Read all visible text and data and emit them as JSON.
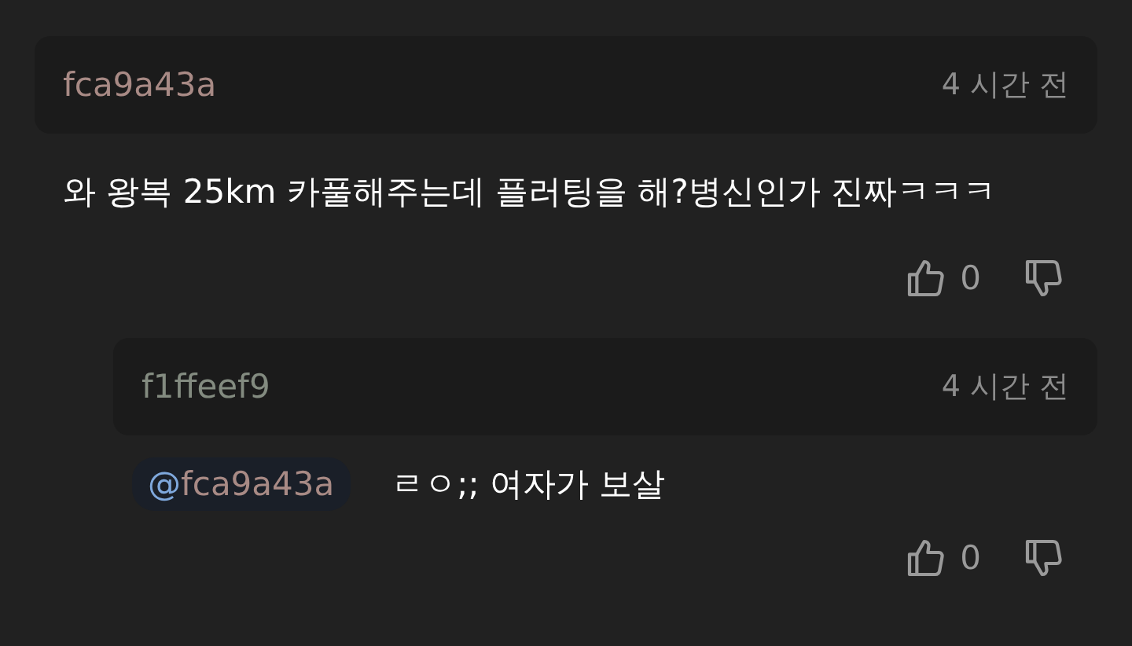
{
  "comments": [
    {
      "author": "fca9a43a",
      "color": "#a88a85",
      "time": "4 시간 전",
      "text": "와 왕복 25km 카풀해주는데 플러팅을 해?병신인가 진짜ㅋㅋㅋ",
      "likes": "0",
      "replies": [
        {
          "author": "f1ffeef9",
          "color": "#838b80",
          "time": "4 시간 전",
          "mention": {
            "symbol": "@",
            "name": "fca9a43a"
          },
          "text": "ㄹㅇ;; 여자가 보살",
          "likes": "0"
        }
      ]
    }
  ]
}
